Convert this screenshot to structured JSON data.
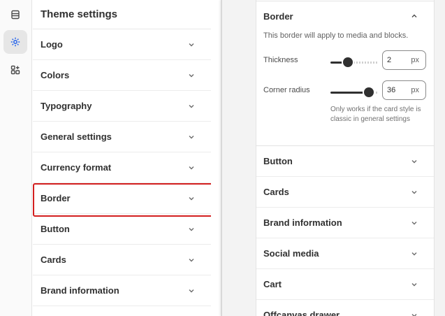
{
  "sidebar": {
    "title": "Theme settings",
    "items": [
      {
        "label": "Logo"
      },
      {
        "label": "Colors"
      },
      {
        "label": "Typography"
      },
      {
        "label": "General settings"
      },
      {
        "label": "Currency format"
      },
      {
        "label": "Border"
      },
      {
        "label": "Button"
      },
      {
        "label": "Cards"
      },
      {
        "label": "Brand information"
      }
    ],
    "highlighted": "Border"
  },
  "rail": {
    "icons": [
      "sections-icon",
      "gear-icon",
      "apps-icon"
    ],
    "active": "gear-icon"
  },
  "detail": {
    "section": {
      "title": "Border",
      "description": "This border will apply to media and blocks.",
      "thickness": {
        "label": "Thickness",
        "value": "2",
        "unit": "px",
        "level": 0.3
      },
      "corner_radius": {
        "label": "Corner radius",
        "value": "36",
        "unit": "px",
        "level": 0.9
      },
      "hint": "Only works if the card style is classic in general settings"
    },
    "items": [
      {
        "label": "Button"
      },
      {
        "label": "Cards"
      },
      {
        "label": "Brand information"
      },
      {
        "label": "Social media"
      },
      {
        "label": "Cart"
      },
      {
        "label": "Offcanvas drawer"
      }
    ]
  },
  "colors": {
    "highlight": "#d31f1f",
    "text": "#303030"
  }
}
